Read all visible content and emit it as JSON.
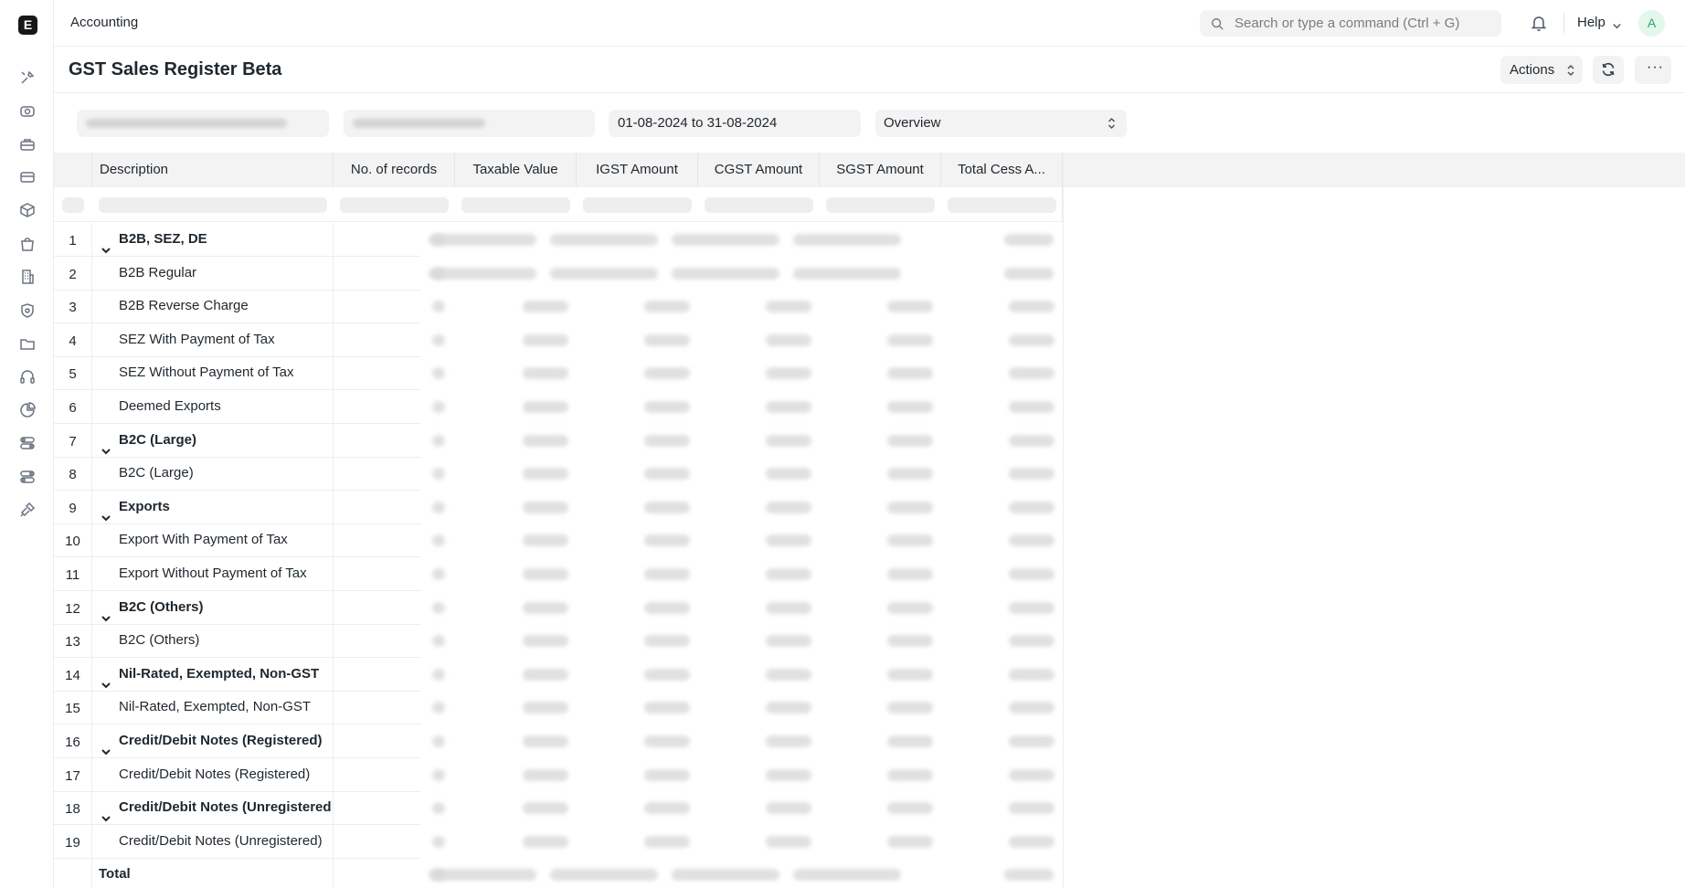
{
  "topbar": {
    "breadcrumb": "Accounting",
    "search_placeholder": "Search or type a command (Ctrl + G)",
    "help_label": "Help",
    "avatar_initial": "A",
    "logo_letter": "E"
  },
  "sidebar": {
    "icons": [
      "tools-icon",
      "eye-icon",
      "briefcase-icon",
      "card-icon",
      "box-icon",
      "bag-icon",
      "building-icon",
      "shield-icon",
      "folder-icon",
      "headset-icon",
      "pie-chart-icon",
      "toggle-icon",
      "toggle-alt-icon",
      "plug-icon"
    ]
  },
  "page": {
    "title": "GST Sales Register Beta",
    "actions_label": "Actions",
    "more_label": "···"
  },
  "filters": {
    "date_range": "01-08-2024 to 31-08-2024",
    "report_type": "Overview"
  },
  "table": {
    "columns": [
      "Description",
      "No. of records",
      "Taxable Value",
      "IGST Amount",
      "CGST Amount",
      "SGST Amount",
      "Total Cess A..."
    ],
    "rows": [
      {
        "num": "1",
        "label": "B2B, SEZ, DE",
        "group": true
      },
      {
        "num": "2",
        "label": "B2B Regular",
        "group": false
      },
      {
        "num": "3",
        "label": "B2B Reverse Charge",
        "group": false
      },
      {
        "num": "4",
        "label": "SEZ With Payment of Tax",
        "group": false
      },
      {
        "num": "5",
        "label": "SEZ Without Payment of Tax",
        "group": false
      },
      {
        "num": "6",
        "label": "Deemed Exports",
        "group": false
      },
      {
        "num": "7",
        "label": "B2C (Large)",
        "group": true
      },
      {
        "num": "8",
        "label": "B2C (Large)",
        "group": false
      },
      {
        "num": "9",
        "label": "Exports",
        "group": true
      },
      {
        "num": "10",
        "label": "Export With Payment of Tax",
        "group": false
      },
      {
        "num": "11",
        "label": "Export Without Payment of Tax",
        "group": false
      },
      {
        "num": "12",
        "label": "B2C (Others)",
        "group": true
      },
      {
        "num": "13",
        "label": "B2C (Others)",
        "group": false
      },
      {
        "num": "14",
        "label": "Nil-Rated, Exempted, Non-GST",
        "group": true
      },
      {
        "num": "15",
        "label": "Nil-Rated, Exempted, Non-GST",
        "group": false
      },
      {
        "num": "16",
        "label": "Credit/Debit Notes (Registered)",
        "group": true
      },
      {
        "num": "17",
        "label": "Credit/Debit Notes (Registered)",
        "group": false
      },
      {
        "num": "18",
        "label": "Credit/Debit Notes (Unregistered",
        "group": true
      },
      {
        "num": "19",
        "label": "Credit/Debit Notes (Unregistered)",
        "group": false
      }
    ],
    "total_label": "Total"
  }
}
